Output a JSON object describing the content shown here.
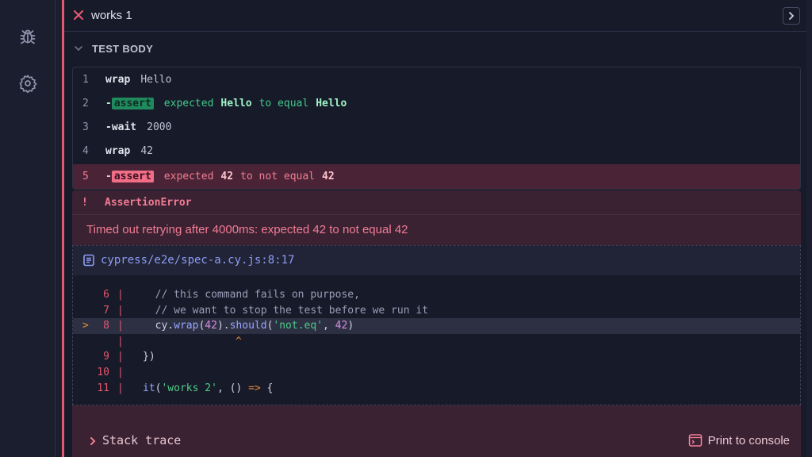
{
  "sidebar": {
    "icons": [
      "bug-icon",
      "gear-icon"
    ]
  },
  "test": {
    "title": "works 1",
    "status_icon": "close-icon"
  },
  "section": {
    "title": "TEST BODY"
  },
  "commands": [
    {
      "num": "1",
      "name": "wrap",
      "message": "Hello"
    },
    {
      "num": "2",
      "badge": "assert",
      "msg_parts": [
        "expected",
        "Hello",
        "to equal",
        "Hello"
      ]
    },
    {
      "num": "3",
      "name": "wait",
      "message": "2000"
    },
    {
      "num": "4",
      "name": "wrap",
      "message": "42"
    },
    {
      "num": "5",
      "badge": "assert",
      "msg_parts": [
        "expected",
        "42",
        "to not equal",
        "42"
      ]
    }
  ],
  "error": {
    "bang": "!",
    "name": "AssertionError",
    "message": "Timed out retrying after 4000ms: expected 42 to not equal 42",
    "file": "cypress/e2e/spec-a.cy.js:8:17",
    "code_lines": [
      {
        "num": "6",
        "code": "  // this command fails on purpose,"
      },
      {
        "num": "7",
        "code": "  // we want to stop the test before we run it"
      },
      {
        "num": "8",
        "marker": ">",
        "code": "  cy.wrap(42).should('not.eq', 42)"
      },
      {
        "num": "",
        "caret": "^"
      },
      {
        "num": "9",
        "code": "})"
      },
      {
        "num": "10",
        "code": ""
      },
      {
        "num": "11",
        "code": "it('works 2', () => {"
      }
    ]
  },
  "footer": {
    "stack_trace": "Stack trace",
    "print": "Print to console"
  },
  "colors": {
    "fail": "#e45770",
    "pass": "#1f8a5e",
    "link": "#8f9cf5"
  }
}
